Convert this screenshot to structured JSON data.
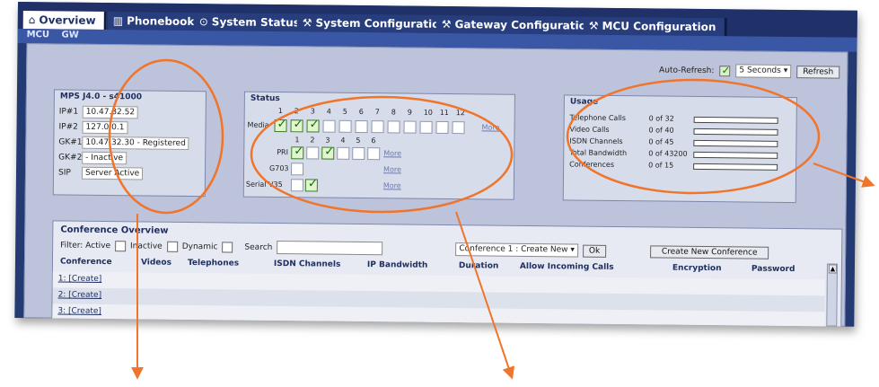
{
  "tabs": [
    {
      "label": "Overview",
      "icon": "home-icon",
      "active": true
    },
    {
      "label": "Phonebook",
      "icon": "book-icon",
      "active": false
    },
    {
      "label": "System Status",
      "icon": "status-icon",
      "active": false
    },
    {
      "label": "System Configuration",
      "icon": "wrench-icon",
      "active": false
    },
    {
      "label": "Gateway Configuration",
      "icon": "wrench-icon",
      "active": false
    },
    {
      "label": "MCU Configuration",
      "icon": "wrench-icon",
      "active": false
    }
  ],
  "subnav": [
    "MCU",
    "GW"
  ],
  "refresh": {
    "label": "Auto-Refresh:",
    "interval": "5 Seconds",
    "button": "Refresh"
  },
  "mps": {
    "title": "MPS J4.0 - s41000",
    "rows": [
      {
        "key": "IP#1",
        "value": "10.47.32.52"
      },
      {
        "key": "IP#2",
        "value": "127.0.0.1"
      },
      {
        "key": "GK#1",
        "value": "10.47.32.30 - Registered"
      },
      {
        "key": "GK#2",
        "value": "- Inactive"
      },
      {
        "key": "SIP",
        "value": "Server Active"
      }
    ]
  },
  "status": {
    "title": "Status",
    "media_numbers": [
      "1",
      "2",
      "3",
      "4",
      "5",
      "6",
      "7",
      "8",
      "9",
      "10",
      "11",
      "12"
    ],
    "pri_numbers": [
      "1",
      "2",
      "3",
      "4",
      "5",
      "6"
    ],
    "media_label": "Media",
    "pri_label": "PRI",
    "g703_label": "G703",
    "serial_label": "Serial V35",
    "more": "More"
  },
  "usage": {
    "title": "Usage",
    "rows": [
      {
        "label": "Telephone Calls",
        "value": "0 of 32",
        "fill": 0
      },
      {
        "label": "Video Calls",
        "value": "0 of 40",
        "fill": 0
      },
      {
        "label": "ISDN Channels",
        "value": "0 of 45",
        "fill": 0
      },
      {
        "label": "Total Bandwidth",
        "value": "0 of 43200",
        "fill": 0
      },
      {
        "label": "Conferences",
        "value": "0 of 15",
        "fill": 0
      }
    ]
  },
  "conference": {
    "title": "Conference Overview",
    "filter_label": "Filter: Active",
    "inactive_label": "Inactive",
    "dynamic_label": "Dynamic",
    "search_label": "Search",
    "select_value": "Conference 1 : Create New",
    "ok": "Ok",
    "create_button": "Create New Conference",
    "columns": [
      "Conference",
      "Videos",
      "Telephones",
      "ISDN Channels",
      "IP Bandwidth",
      "Duration",
      "Allow Incoming Calls",
      "Encryption",
      "Password"
    ],
    "rows": [
      "1: [Create]",
      "2: [Create]",
      "3: [Create]"
    ]
  },
  "colors": {
    "annotation": "#f0742a",
    "header": "#1f3168"
  }
}
